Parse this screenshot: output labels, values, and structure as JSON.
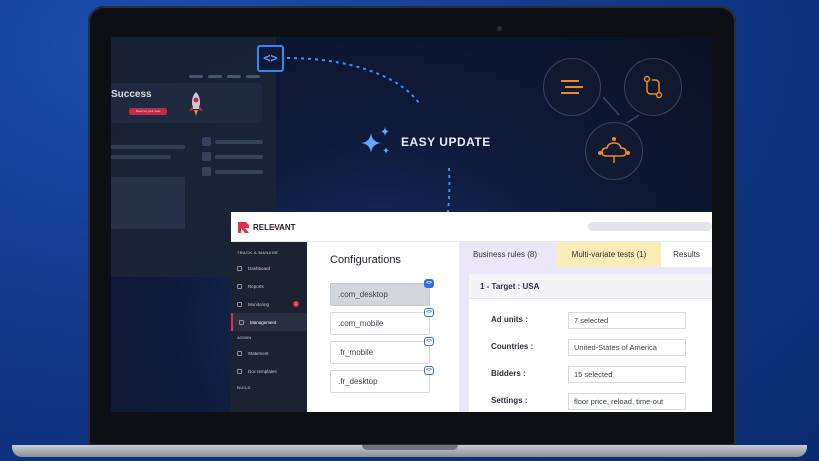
{
  "background_app": {
    "success_title": "Success",
    "success_button": "Reserve your seat"
  },
  "overlay": {
    "easy_update_label": "EASY UPDATE",
    "code_icon_glyph": "<>"
  },
  "app": {
    "logo_text": "RELEVANT",
    "logo_subtext": "YIELD",
    "brand_color": "#e0304a",
    "sidebar": {
      "section_track": "TRACK & MANAGE",
      "items_track": [
        {
          "label": "Dashboard",
          "icon": "dashboard-icon"
        },
        {
          "label": "Reports",
          "icon": "reports-icon"
        },
        {
          "label": "Monitoring",
          "icon": "monitoring-icon",
          "badge": "1"
        },
        {
          "label": "Management",
          "icon": "management-icon",
          "active": true
        }
      ],
      "section_admin": "ADMIN",
      "items_admin": [
        {
          "label": "Statement",
          "icon": "statement-icon"
        },
        {
          "label": "Doc templates",
          "icon": "doc-templates-icon"
        }
      ],
      "section_build": "BUILD"
    },
    "configurations": {
      "title": "Configurations",
      "items": [
        ".com_desktop",
        ".com_mobile",
        ".fr_mobile",
        ".fr_desktop"
      ],
      "selected": ".com_desktop"
    },
    "tabs": [
      "Business rules (8)",
      "Multi-variate tests (1)",
      "Results"
    ],
    "target": {
      "heading": "1 - Target : USA",
      "fields": [
        {
          "label": "Ad units :",
          "value": "7 selected"
        },
        {
          "label": "Countries :",
          "value": "United-States of America"
        },
        {
          "label": "Bidders :",
          "value": "15 selected"
        },
        {
          "label": "Settings :",
          "value": "floor price, reload, time-out"
        }
      ]
    }
  }
}
